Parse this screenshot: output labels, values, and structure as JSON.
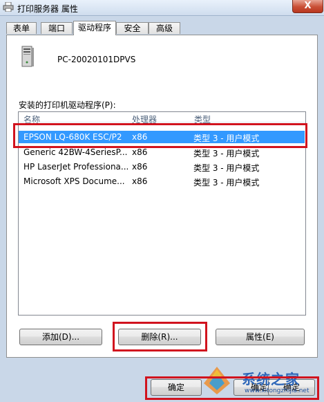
{
  "window": {
    "title": "打印服务器 属性",
    "close_label": "X"
  },
  "tabs": [
    {
      "label": "表单"
    },
    {
      "label": "端口"
    },
    {
      "label": "驱动程序"
    },
    {
      "label": "安全"
    },
    {
      "label": "高级"
    }
  ],
  "active_tab": "驱动程序",
  "server": {
    "name": "PC-20020101DPVS",
    "icon": "server-tower-icon"
  },
  "drivers": {
    "label": "安装的打印机驱动程序(P):",
    "columns": [
      "名称",
      "处理器",
      "类型"
    ],
    "rows": [
      {
        "name": "EPSON LQ-680K ESC/P2",
        "processor": "x86",
        "type": "类型 3 - 用户模式",
        "selected": true
      },
      {
        "name": "Generic 42BW-4SeriesP...",
        "processor": "x86",
        "type": "类型 3 - 用户模式"
      },
      {
        "name": "HP LaserJet Professiona...",
        "processor": "x86",
        "type": "类型 3 - 用户模式"
      },
      {
        "name": "Microsoft XPS Docume...",
        "processor": "x86",
        "type": "类型 3 - 用户模式"
      }
    ]
  },
  "buttons": {
    "add": "添加(D)...",
    "remove": "删除(R)...",
    "properties": "属性(E)",
    "ok": "确定",
    "ok2": "确定",
    "ok3": "确定"
  },
  "watermark": {
    "text": "系统之家",
    "url": "www.xitongzhijia.net"
  },
  "colors": {
    "highlight": "#d1131e",
    "selection": "#3399ff"
  }
}
